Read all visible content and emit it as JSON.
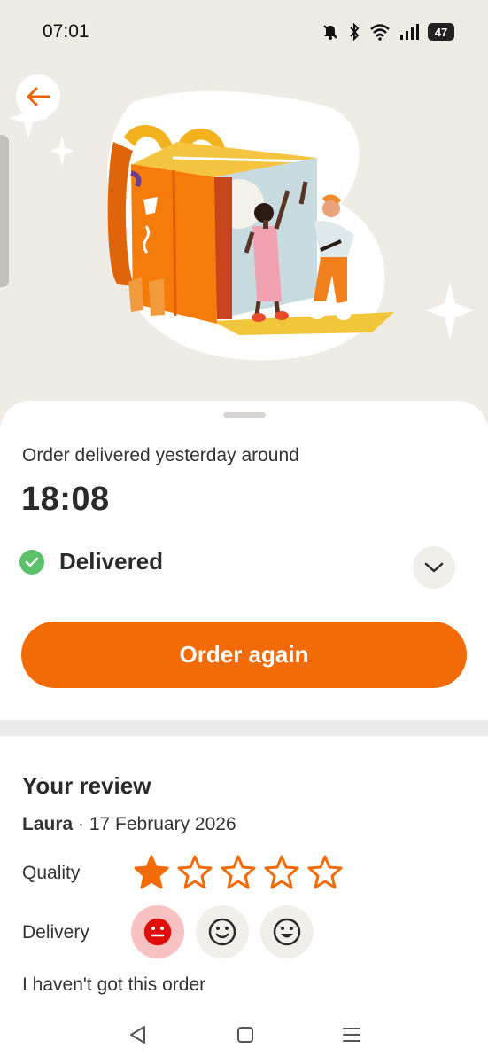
{
  "status_bar": {
    "time": "07:01",
    "icons": [
      "bell-off-icon",
      "bluetooth-icon",
      "wifi-icon",
      "signal-icon",
      "battery-icon"
    ],
    "battery_level": "47"
  },
  "header": {
    "back_icon": "arrow-left-icon"
  },
  "order": {
    "delivered_caption": "Order delivered yesterday around",
    "delivered_time": "18:08",
    "status_label": "Delivered",
    "status_icon": "check-circle-icon",
    "status_color": "#5bc26b",
    "expand_icon": "chevron-down-icon",
    "order_again_label": "Order again"
  },
  "review": {
    "title": "Your review",
    "reviewer": "Laura",
    "separator": " · ",
    "date": "17 February 2026",
    "quality_label": "Quality",
    "quality_rating": 1,
    "quality_max": 5,
    "delivery_label": "Delivery",
    "delivery_options": [
      "neutral-face-icon",
      "smile-face-icon",
      "grin-face-icon"
    ],
    "delivery_selected": 0,
    "not_received_label": "I haven't got this order"
  },
  "navigation": {
    "icons": [
      "back-triangle-icon",
      "home-square-icon",
      "recents-menu-icon"
    ]
  },
  "colors": {
    "accent": "#f26b06",
    "hero_background": "#efebe5",
    "selected_face_bg": "#f9c2c2",
    "selected_face": "#e00d0d"
  }
}
